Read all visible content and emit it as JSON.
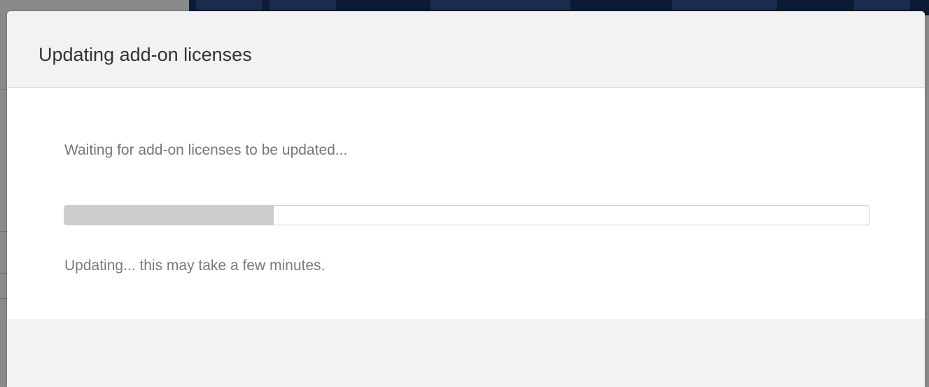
{
  "modal": {
    "title": "Updating add-on licenses",
    "message": "Waiting for add-on licenses to be updated...",
    "progress": {
      "percent": 26
    },
    "status": "Updating... this may take a few minutes."
  },
  "colors": {
    "header_background": "#f2f2f2",
    "body_background": "#ffffff",
    "progress_fill": "#cccccc",
    "backdrop_nav": "#0c1a33"
  }
}
